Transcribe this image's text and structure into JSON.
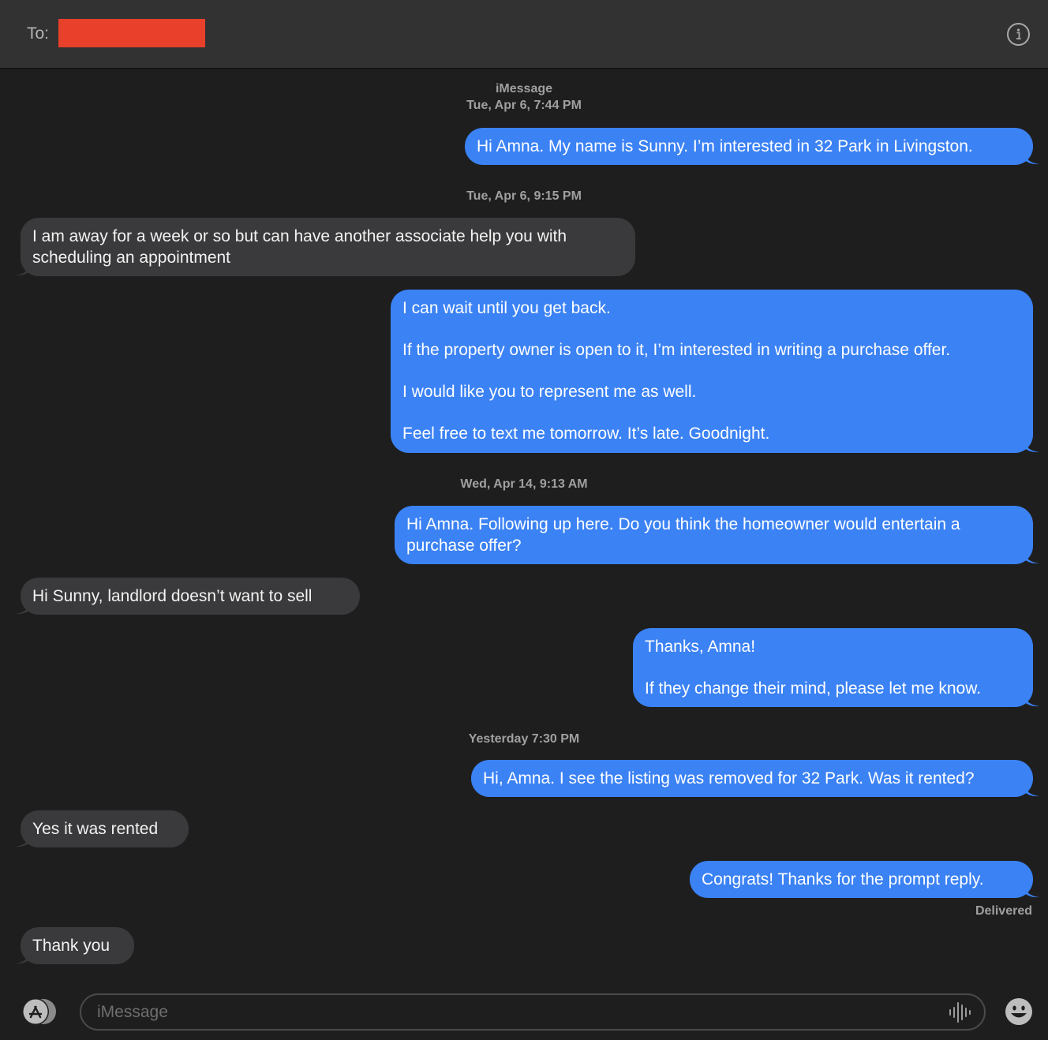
{
  "header": {
    "to_label": "To:",
    "info_icon": "info-icon"
  },
  "service_label": "iMessage",
  "timestamps": [
    "Tue, Apr 6, 7:44 PM",
    "Tue, Apr 6, 9:15 PM",
    "Wed, Apr 14, 9:13 AM",
    "Yesterday 7:30 PM"
  ],
  "messages": [
    {
      "sender": "me",
      "paragraphs": [
        "Hi Amna. My name is Sunny. I’m interested in 32 Park in Livingston."
      ]
    },
    {
      "sender": "them",
      "paragraphs": [
        "I am away for a week or so but can have another associate help you with",
        "scheduling an appointment"
      ]
    },
    {
      "sender": "me",
      "paragraphs": [
        "I can wait until you get back.",
        "If the property owner is open to it, I’m interested in writing a purchase offer.",
        "I would like you to represent me as well.",
        "Feel free to text me tomorrow. It’s late. Goodnight."
      ]
    },
    {
      "sender": "me",
      "paragraphs": [
        "Hi Amna. Following up here. Do you think the homeowner would entertain a",
        "purchase offer?"
      ]
    },
    {
      "sender": "them",
      "paragraphs": [
        "Hi Sunny, landlord doesn’t want to sell"
      ]
    },
    {
      "sender": "me",
      "paragraphs": [
        "Thanks, Amna!",
        "If they change their mind, please let me know."
      ]
    },
    {
      "sender": "me",
      "paragraphs": [
        "Hi, Amna. I see the listing was removed for 32 Park. Was it rented?"
      ]
    },
    {
      "sender": "them",
      "paragraphs": [
        "Yes it was rented"
      ]
    },
    {
      "sender": "me",
      "paragraphs": [
        "Congrats! Thanks for the prompt reply."
      ]
    },
    {
      "sender": "them",
      "paragraphs": [
        "Thank you"
      ]
    }
  ],
  "status": "Delivered",
  "composer": {
    "placeholder": "iMessage",
    "apps_icon": "app-store-icon",
    "audio_icon": "audio-waveform-icon",
    "emoji_icon": "emoji-icon"
  },
  "colors": {
    "outgoing_bubble": "#3b82f4",
    "incoming_bubble": "#3a3a3c",
    "redaction": "#e8402a",
    "background": "#1e1e1e"
  }
}
